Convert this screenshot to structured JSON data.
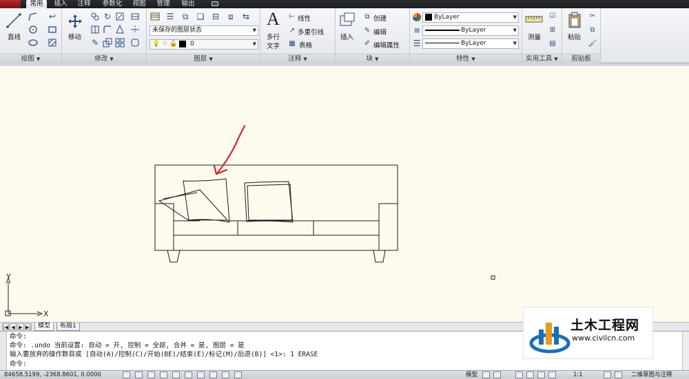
{
  "tabs": [
    {
      "label": "常用",
      "active": true
    },
    {
      "label": "插入",
      "active": false
    },
    {
      "label": "注释",
      "active": false
    },
    {
      "label": "参数化",
      "active": false
    },
    {
      "label": "视图",
      "active": false
    },
    {
      "label": "管理",
      "active": false
    },
    {
      "label": "输出",
      "active": false
    }
  ],
  "ribbon": {
    "draw": {
      "title": "绘图",
      "line_label": "直线"
    },
    "modify": {
      "title": "修改",
      "move_label": "移动"
    },
    "layers": {
      "title": "图层",
      "layer_state": "未保存的图层状态",
      "current_layer": "0"
    },
    "annotation": {
      "title": "注释",
      "mtext_label": "多行",
      "mtext_label2": "文字",
      "linear_label": "线性",
      "mleader_label": "多重引线",
      "table_label": "表格"
    },
    "block": {
      "title": "块",
      "insert_label": "插入",
      "create_label": "创建",
      "edit_label": "编辑",
      "edit_attr_label": "编辑属性"
    },
    "properties": {
      "title": "特性",
      "color": "ByLayer",
      "lineweight": "ByLayer",
      "linetype": "ByLayer"
    },
    "utilities": {
      "title": "实用工具",
      "measure_label": "测量"
    },
    "clipboard": {
      "title": "剪贴板",
      "paste_label": "粘贴"
    }
  },
  "layout_tabs": [
    "模型",
    "布局1"
  ],
  "command_lines": [
    "命令:",
    "命令:  .undo 当前设置: 自动 = 开, 控制 = 全部, 合并 = 是, 图层 = 是",
    "输入要放弃的操作数目或 [自动(A)/控制(C)/开始(BE)/结束(E)/标记(M)/后退(B)] <1>: 1 ERASE",
    "命令:"
  ],
  "status": {
    "coordinates": "84658.5199,  -2368.8601,  0.0000",
    "model_label": "模型",
    "scale": "1:1",
    "workspace": "二维草图与注释"
  },
  "ucs": {
    "x_label": "X",
    "y_label": "Y"
  },
  "watermark": {
    "name": "土木工程网",
    "url": "www.civilcn.com"
  },
  "colors": {
    "annotation_arrow": "#e0202a",
    "canvas_bg": "#fdfbee",
    "brand_blue": "#1b6fb5"
  }
}
